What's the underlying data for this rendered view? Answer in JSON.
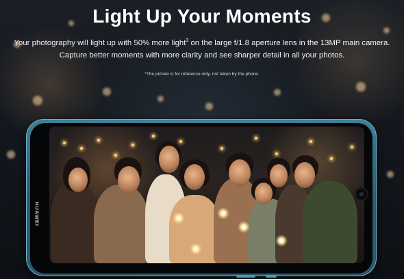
{
  "headline": "Light Up Your Moments",
  "copy": {
    "line1_before": "Your photography will light up with 50% more light",
    "line1_sup": "3",
    "line1_after": " on the large f/1.8 aperture lens in the 13MP main camera.",
    "line2": "Capture better moments with more clarity and see sharper detail in all your photos."
  },
  "disclaimer": "*The picture is for reference only, not taken by the phone.",
  "phone": {
    "brand": "HUAWEI",
    "body_color": "#3f7f98"
  }
}
